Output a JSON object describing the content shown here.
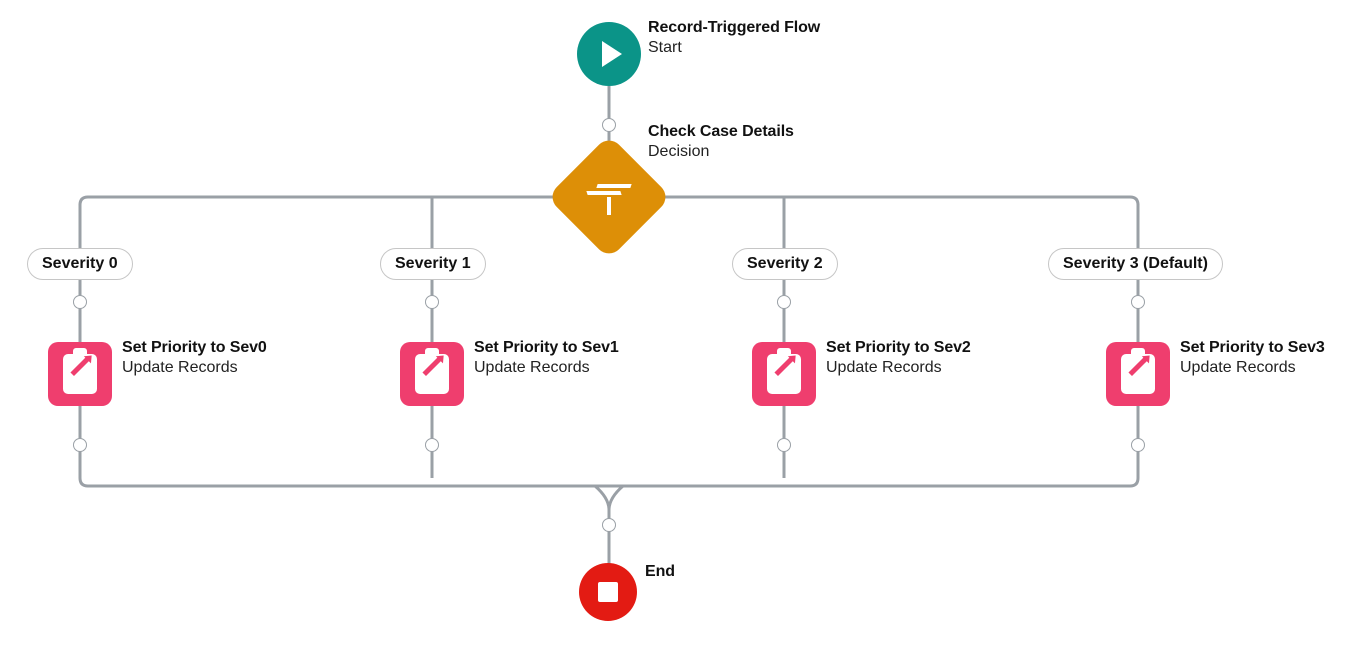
{
  "colors": {
    "start": "#0b9488",
    "decision": "#dd8f07",
    "update": "#ef3e6e",
    "end": "#e31b13",
    "line": "#9aa0a6",
    "pill_border": "#c6c6c6"
  },
  "nodes": {
    "start": {
      "title": "Record-Triggered Flow",
      "subtitle": "Start",
      "icon": "play-icon"
    },
    "decision": {
      "title": "Check Case Details",
      "subtitle": "Decision",
      "icon": "signpost-icon"
    },
    "branches": [
      {
        "label": "Severity 0",
        "action_title": "Set Priority to Sev0",
        "action_subtitle": "Update Records",
        "icon": "clipboard-edit-icon"
      },
      {
        "label": "Severity 1",
        "action_title": "Set Priority to Sev1",
        "action_subtitle": "Update Records",
        "icon": "clipboard-edit-icon"
      },
      {
        "label": "Severity 2",
        "action_title": "Set Priority to Sev2",
        "action_subtitle": "Update Records",
        "icon": "clipboard-edit-icon"
      },
      {
        "label": "Severity 3 (Default)",
        "action_title": "Set Priority to Sev3",
        "action_subtitle": "Update Records",
        "icon": "clipboard-edit-icon"
      }
    ],
    "end": {
      "title": "End",
      "icon": "stop-icon"
    }
  }
}
